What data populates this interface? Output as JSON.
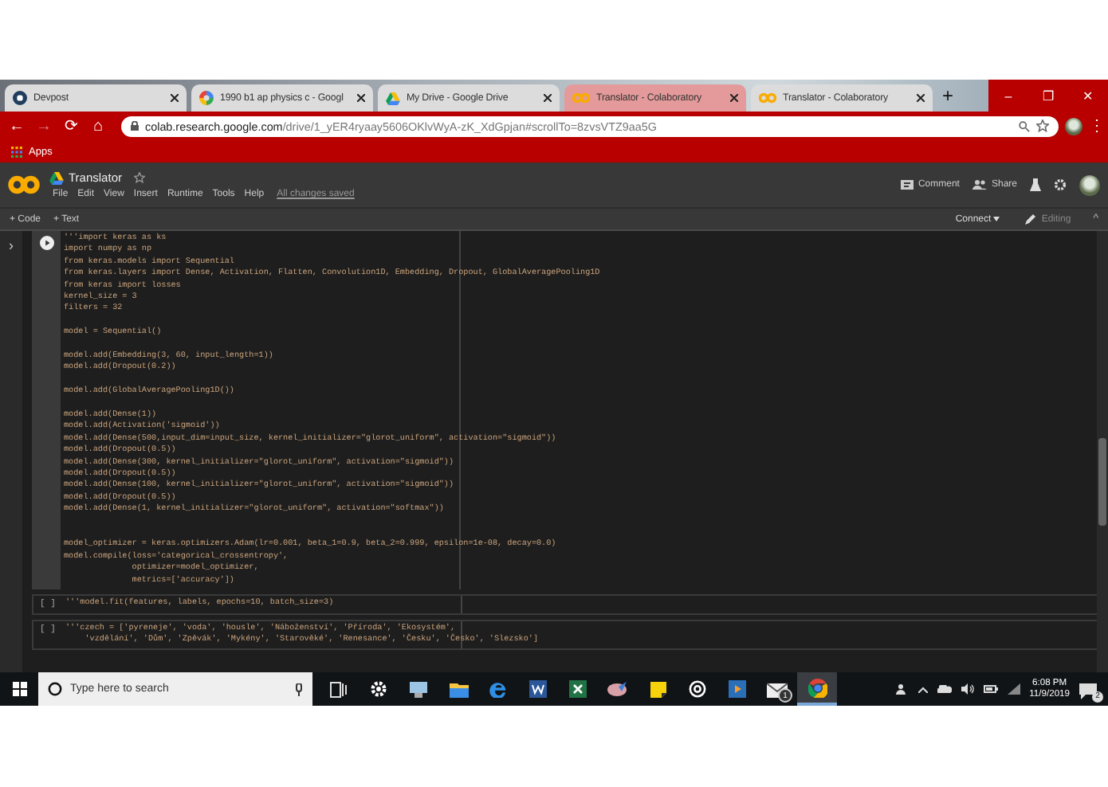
{
  "browser": {
    "tabs": [
      {
        "kind": "devpost",
        "title": "Devpost",
        "selected": false
      },
      {
        "kind": "google",
        "title": "1990 b1 ap physics c - Googl",
        "selected": false
      },
      {
        "kind": "drive",
        "title": "My Drive - Google Drive",
        "selected": false
      },
      {
        "kind": "colab",
        "title": "Translator - Colaboratory",
        "selected": true
      },
      {
        "kind": "colab",
        "title": "Translator - Colaboratory",
        "selected": false
      }
    ],
    "new_tab": "+",
    "window_controls": [
      "–",
      "❐",
      "✕"
    ],
    "nav": [
      {
        "glyph": "←",
        "disabled": false
      },
      {
        "glyph": "→",
        "disabled": true
      },
      {
        "glyph": "⟳",
        "disabled": false
      },
      {
        "glyph": "⌂",
        "disabled": false
      }
    ],
    "address_host": "colab.research.google.com",
    "address_path": "/drive/1_yER4ryaay5606OKlvWyA-zK_XdGpjan#scrollTo=8zvsVTZ9aa5G",
    "menu_glyph": "⋮",
    "bookmarks": [
      "Apps"
    ]
  },
  "colab": {
    "title": "Translator",
    "menu": [
      "File",
      "Edit",
      "View",
      "Insert",
      "Runtime",
      "Tools",
      "Help"
    ],
    "save_status": "All changes saved",
    "actions": [
      {
        "kind": "comment",
        "label": "Comment"
      },
      {
        "kind": "share",
        "label": "Share"
      }
    ],
    "insert": [
      "+ Code",
      "+ Text"
    ],
    "connect": "Connect",
    "mode": "Editing",
    "sidebar_toggle": "›",
    "collapse": "^"
  },
  "cells": [
    {
      "kind": "run",
      "blocks": [
        {
          "kind": "normal",
          "lines": [
            "'''import keras as ks",
            "import numpy as np",
            "from keras.models import Sequential",
            "from keras.layers import Dense, Activation, Flatten, Convolution1D, Embedding, Dropout, GlobalAveragePooling1D",
            "from keras import losses",
            "kernel_size = 3",
            "filters = 32"
          ]
        },
        {
          "kind": "normal",
          "lines": [
            "model = Sequential()"
          ]
        },
        {
          "kind": "normal",
          "lines": [
            "model.add(Embedding(3, 60, input_length=1))",
            "model.add(Dropout(0.2))"
          ]
        },
        {
          "kind": "normal",
          "lines": [
            "model.add(GlobalAveragePooling1D())"
          ]
        },
        {
          "kind": "normal",
          "lines": [
            "model.add(Dense(1))",
            "model.add(Activation('sigmoid'))",
            "model.add(Dense(500,input_dim=input_size, kernel_initializer=\"glorot_uniform\", activation=\"sigmoid\"))",
            "model.add(Dropout(0.5))",
            "model.add(Dense(300, kernel_initializer=\"glorot_uniform\", activation=\"sigmoid\"))",
            "model.add(Dropout(0.5))",
            "model.add(Dense(100, kernel_initializer=\"glorot_uniform\", activation=\"sigmoid\"))",
            "model.add(Dropout(0.5))",
            "model.add(Dense(1, kernel_initializer=\"glorot_uniform\", activation=\"softmax\"))"
          ]
        },
        {
          "kind": "spaced",
          "lines": [
            "model_optimizer = keras.optimizers.Adam(lr=0.001, beta_1=0.9, beta_2=0.999, epsilon=1e-08, decay=0.0)",
            "model.compile(loss='categorical_crossentropy',",
            "              optimizer=model_optimizer,",
            "              metrics=['accuracy'])"
          ]
        }
      ]
    },
    {
      "kind": "prompt",
      "prompt": "[ ]",
      "blocks": [
        {
          "kind": "normal",
          "lines": [
            "'''model.fit(features, labels, epochs=10, batch_size=3)"
          ]
        }
      ]
    },
    {
      "kind": "prompt",
      "prompt": "[ ]",
      "blocks": [
        {
          "kind": "normal",
          "lines": [
            "'''czech = ['pyreneje', 'voda', 'housle', 'Náboženství', 'Příroda', 'Ekosystém',",
            "    'vzdělání', 'Dům', 'Zpěvák', 'Mykény', 'Starověké', 'Renesance', 'Česku', 'Česko', 'Slezsko']"
          ]
        }
      ]
    }
  ],
  "taskbar": {
    "search_placeholder": "Type here to search",
    "apps": [
      {
        "kind": "taskview",
        "active": false
      },
      {
        "kind": "settings",
        "active": false
      },
      {
        "kind": "computer",
        "active": false
      },
      {
        "kind": "folder",
        "active": false
      },
      {
        "kind": "edge",
        "active": false
      },
      {
        "kind": "word",
        "active": false
      },
      {
        "kind": "excel",
        "active": false
      },
      {
        "kind": "paint",
        "active": false
      },
      {
        "kind": "sticky",
        "active": false
      },
      {
        "kind": "disc",
        "active": false
      },
      {
        "kind": "video",
        "active": false
      },
      {
        "kind": "mail",
        "active": false,
        "badge": "1"
      },
      {
        "kind": "chrome",
        "active": true
      }
    ],
    "time": "6:08 PM",
    "date": "11/9/2019",
    "notifications": "2"
  }
}
